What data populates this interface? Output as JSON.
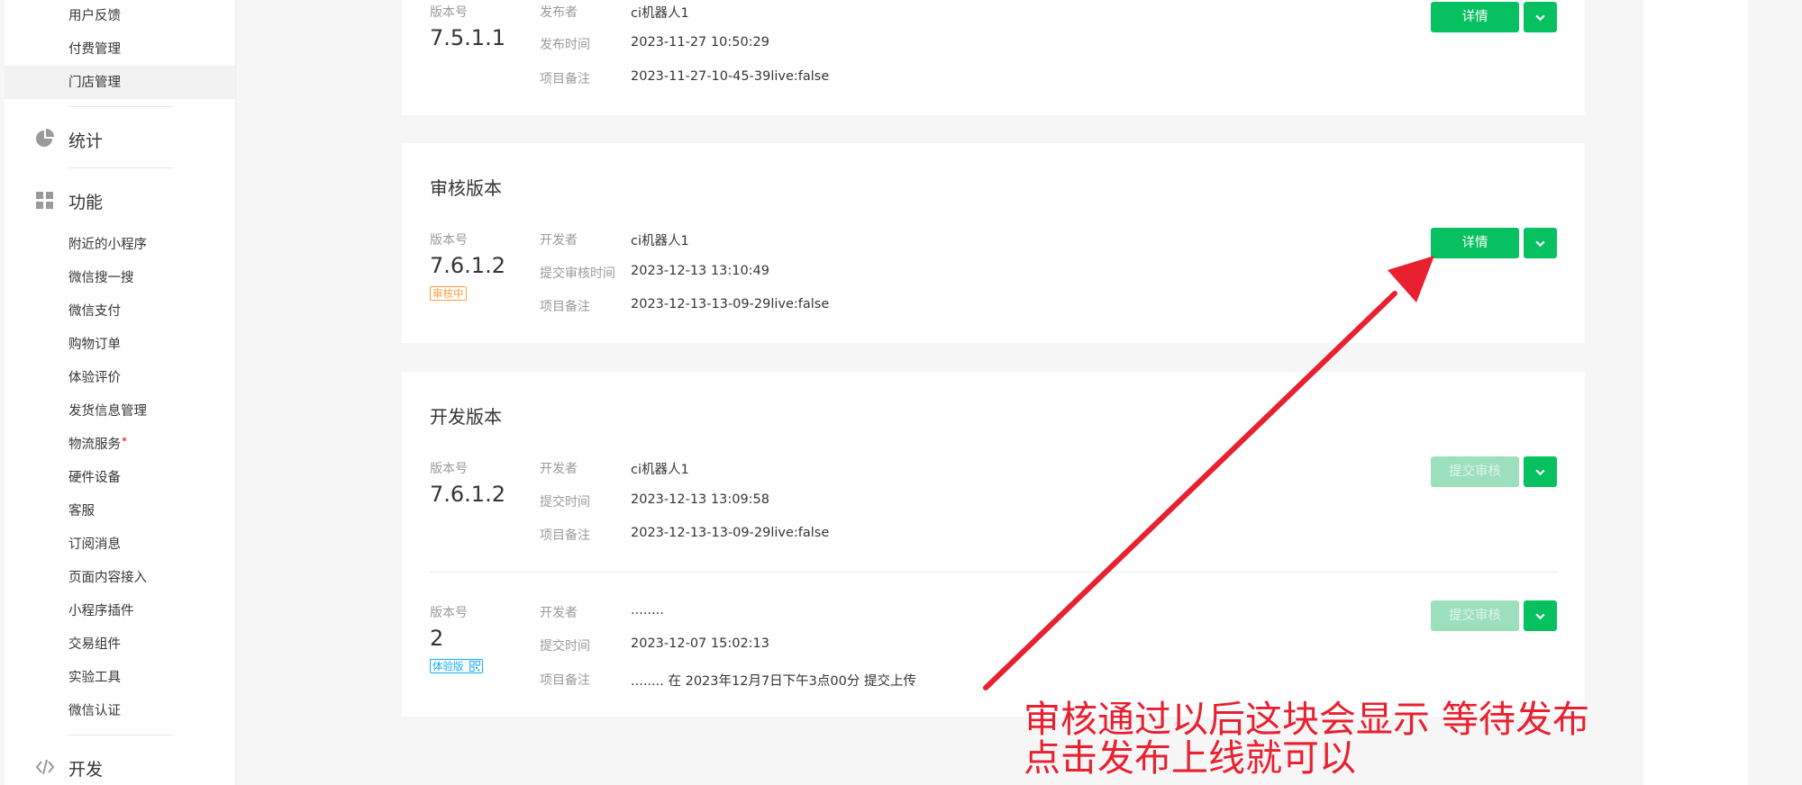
{
  "sidebar": {
    "top_items": [
      {
        "label": "用户反馈"
      },
      {
        "label": "付费管理"
      },
      {
        "label": "门店管理",
        "active": true
      }
    ],
    "section_stats": {
      "label": "统计",
      "icon": "pie-chart-icon"
    },
    "section_features": {
      "label": "功能",
      "icon": "grid-icon",
      "items": [
        {
          "label": "附近的小程序"
        },
        {
          "label": "微信搜一搜"
        },
        {
          "label": "微信支付"
        },
        {
          "label": "购物订单"
        },
        {
          "label": "体验评价"
        },
        {
          "label": "发货信息管理"
        },
        {
          "label": "物流服务",
          "badge_dot": true
        },
        {
          "label": "硬件设备"
        },
        {
          "label": "客服"
        },
        {
          "label": "订阅消息"
        },
        {
          "label": "页面内容接入"
        },
        {
          "label": "小程序插件"
        },
        {
          "label": "交易组件"
        },
        {
          "label": "实验工具"
        },
        {
          "label": "微信认证"
        }
      ]
    },
    "section_dev": {
      "label": "开发",
      "icon": "code-icon"
    }
  },
  "online": {
    "version_label": "版本号",
    "version": "7.5.1.1",
    "rows": [
      {
        "label": "发布者",
        "value": "ci机器人1"
      },
      {
        "label": "发布时间",
        "value": "2023-11-27 10:50:29"
      },
      {
        "label": "项目备注",
        "value": "2023-11-27-10-45-39live:false"
      }
    ],
    "button": "详情"
  },
  "review": {
    "title": "审核版本",
    "version_label": "版本号",
    "version": "7.6.1.2",
    "tag": "审核中",
    "rows": [
      {
        "label": "开发者",
        "value": "ci机器人1"
      },
      {
        "label": "提交审核时间",
        "value": "2023-12-13 13:10:49"
      },
      {
        "label": "项目备注",
        "value": "2023-12-13-13-09-29live:false"
      }
    ],
    "button": "详情"
  },
  "dev": {
    "title": "开发版本",
    "items": [
      {
        "version_label": "版本号",
        "version": "7.6.1.2",
        "rows": [
          {
            "label": "开发者",
            "value": "ci机器人1"
          },
          {
            "label": "提交时间",
            "value": "2023-12-13 13:09:58"
          },
          {
            "label": "项目备注",
            "value": "2023-12-13-13-09-29live:false"
          }
        ],
        "button": "提交审核"
      },
      {
        "version_label": "版本号",
        "version": "2",
        "tag": "体验版",
        "tag_icon": "qrcode-icon",
        "rows": [
          {
            "label": "开发者",
            "value": "........"
          },
          {
            "label": "提交时间",
            "value": "2023-12-07 15:02:13"
          },
          {
            "label": "项目备注",
            "value": "........ 在 2023年12月7日下午3点00分 提交上传"
          }
        ],
        "button": "提交审核"
      }
    ]
  },
  "annotation": {
    "line1": "审核通过以后这块会显示  等待发布",
    "line2": "点击发布上线就可以"
  },
  "colors": {
    "brand_green": "#07c160",
    "disabled_green": "#9bdfbd",
    "review_tag": "#fa9d3b",
    "trial_tag": "#10aeff",
    "annotation_red": "#e8202f"
  }
}
